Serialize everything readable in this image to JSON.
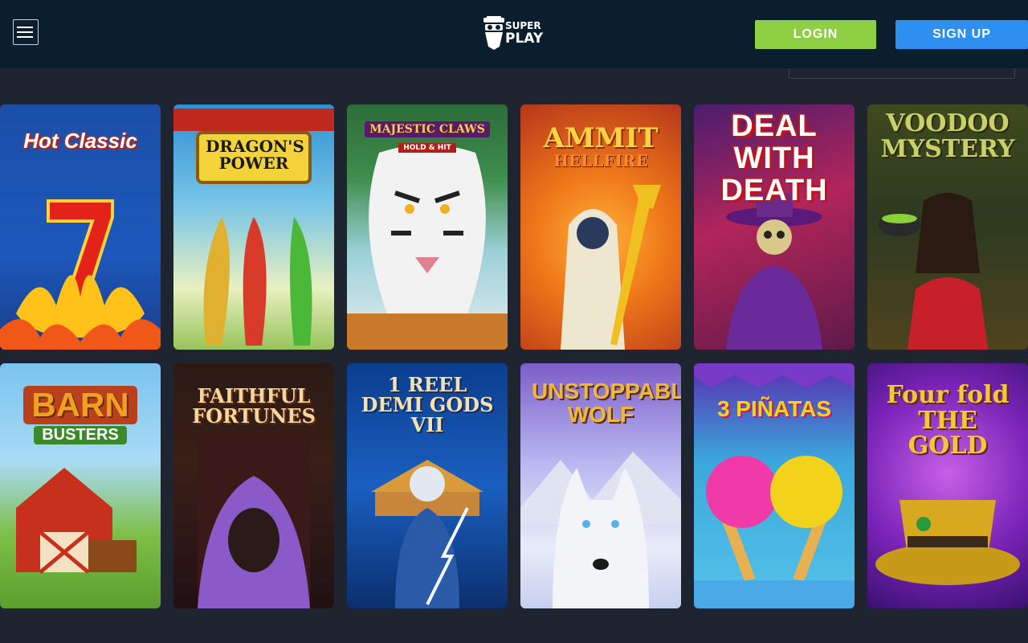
{
  "header": {
    "logo_line1": "SUPER",
    "logo_line2": "PLAY",
    "login_label": "LOGIN",
    "signup_label": "SIGN UP",
    "colors": {
      "background": "#0b1e2e",
      "login": "#8ecf43",
      "signup": "#2d8ff0"
    }
  },
  "games": [
    {
      "title": "Hot Classic"
    },
    {
      "title": "DRAGON'S POWER"
    },
    {
      "title": "MAJESTIC CLAWS",
      "subtitle": "HOLD & HIT"
    },
    {
      "title": "AMMIT",
      "subtitle": "HELLFIRE"
    },
    {
      "title": "DEAL WITH DEATH"
    },
    {
      "title": "VOODOO MYSTERY"
    },
    {
      "title": "BARN",
      "subtitle": "BUSTERS"
    },
    {
      "title": "FAITHFUL FORTUNES"
    },
    {
      "title": "1 REEL DEMI GODS VII"
    },
    {
      "title": "UNSTOPPABLE WOLF"
    },
    {
      "title": "3 PIÑATAS"
    },
    {
      "title": "Four fold THE GOLD"
    }
  ]
}
